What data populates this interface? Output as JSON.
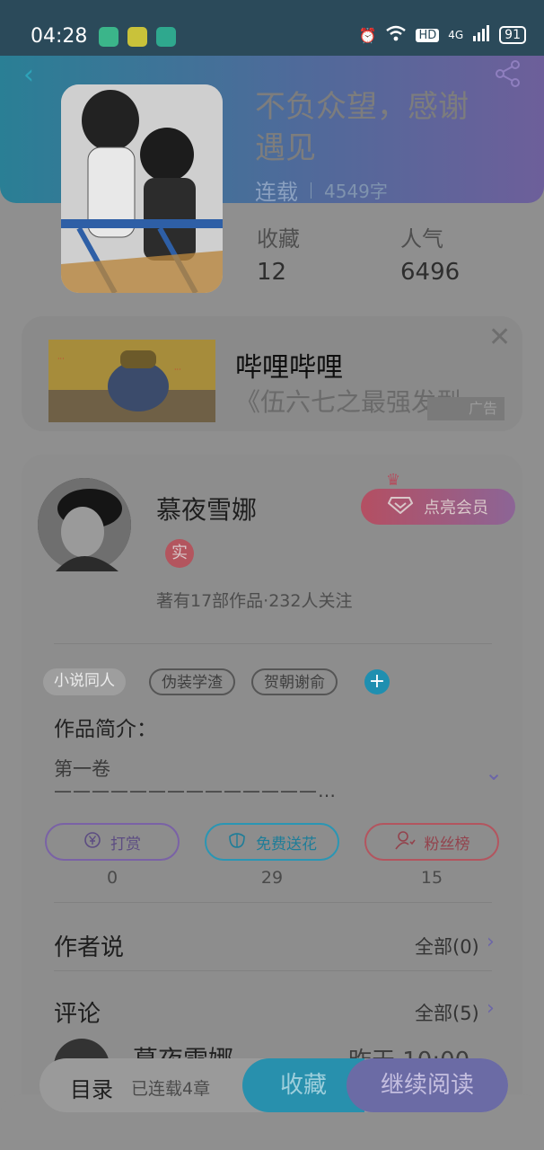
{
  "statusbar": {
    "time": "04:28",
    "network": "4G",
    "hd": "HD",
    "battery": "91",
    "icons": [
      "alarm-icon",
      "wifi-icon",
      "signal-icon"
    ]
  },
  "header": {
    "title": "不负众望，感谢遇见",
    "serial_status": "连载",
    "word_count": "4549字",
    "stats": [
      {
        "label": "收藏",
        "value": "12"
      },
      {
        "label": "人气",
        "value": "6496"
      }
    ]
  },
  "ad": {
    "title": "哔哩哔哩",
    "subtitle": "《伍六七之最强发型",
    "badge": "广告"
  },
  "author": {
    "name": "慕夜雪娜",
    "verify_badge": "实",
    "works_info": "著有17部作品·232人关注",
    "vip_label": "点亮会员"
  },
  "tags": [
    "小说同人",
    "伪装学渣",
    "贺朝谢俞"
  ],
  "intro": {
    "heading": "作品简介：",
    "first_line": "第一卷",
    "second_line": "——————————————…"
  },
  "actions": [
    {
      "label": "打赏",
      "count": "0",
      "icon": "yuan-icon"
    },
    {
      "label": "免费送花",
      "count": "29",
      "icon": "flower-icon"
    },
    {
      "label": "粉丝榜",
      "count": "15",
      "icon": "fans-icon"
    }
  ],
  "author_says": {
    "heading": "作者说",
    "all_label": "全部(0)"
  },
  "comments": {
    "heading": "评论",
    "all_label": "全部(5)",
    "first_name": "慕夜雪娜",
    "first_time": "昨天 10:00"
  },
  "bottom_bar": {
    "toc_label": "目录",
    "chapter_count": "已连载4章",
    "favorite_label": "收藏",
    "continue_label": "继续阅读"
  },
  "colors": {
    "header_start": "#2a7f95",
    "header_end": "#6d5f9a",
    "accent_blue": "#2890ad",
    "accent_purple": "#6b6ba5",
    "accent_red": "#b3555f"
  }
}
